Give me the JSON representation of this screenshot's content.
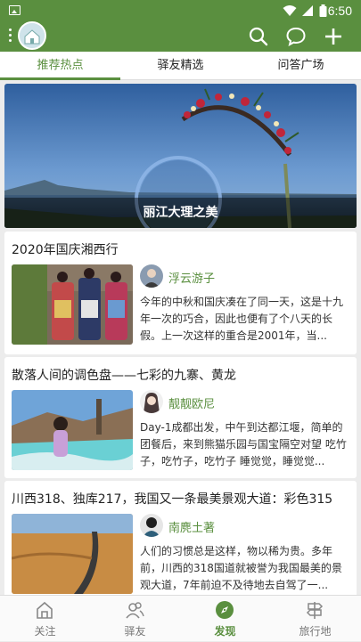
{
  "status_bar": {
    "time": "6:50"
  },
  "tabs": [
    {
      "label": "推荐热点",
      "active": true
    },
    {
      "label": "驿友精选",
      "active": false
    },
    {
      "label": "问答广场",
      "active": false
    }
  ],
  "banner": {
    "caption": "丽江大理之美"
  },
  "posts": [
    {
      "title": "2020年国庆湘西行",
      "author": "浮云游子",
      "excerpt": "今年的中秋和国庆凑在了同一天，这是十九年一次的巧合，因此也便有了个八天的长假。上一次这样的重合是2001年，当..."
    },
    {
      "title": "散落人间的调色盘——七彩的九寨、黄龙",
      "author": "靓靓欧尼",
      "excerpt": "Day-1成都出发，中午到达都江堰，简单的团餐后，来到熊猫乐园与国宝隔空对望 吃竹子，吃竹子，吃竹子 睡觉觉，睡觉觉..."
    },
    {
      "title": "川西318、独库217，我国又一条最美景观大道：彩色315",
      "author": "南麂土著",
      "excerpt": "人们的习惯总是这样，物以稀为贵。多年前，川西的318国道就被誉为我国最美的景观大道，7年前迫不及待地去自驾了一..."
    }
  ],
  "bottom_nav": [
    {
      "label": "关注",
      "icon": "home-icon",
      "active": false
    },
    {
      "label": "驿友",
      "icon": "friends-icon",
      "active": false
    },
    {
      "label": "发现",
      "icon": "compass-icon",
      "active": true
    },
    {
      "label": "旅行地",
      "icon": "signpost-icon",
      "active": false
    }
  ],
  "colors": {
    "primary": "#5a8f3f",
    "background": "#ececec"
  }
}
